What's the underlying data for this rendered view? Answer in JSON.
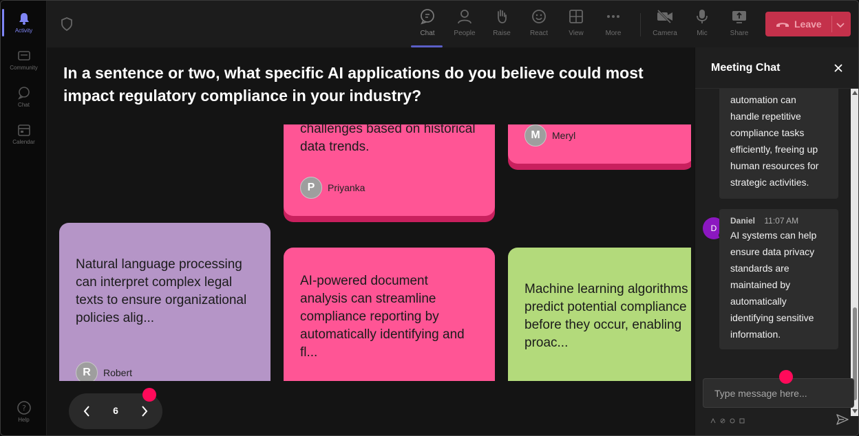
{
  "rail": {
    "items": [
      {
        "label": "Activity",
        "active": true
      },
      {
        "label": "Community",
        "active": false
      },
      {
        "label": "Chat",
        "active": false
      },
      {
        "label": "Calendar",
        "active": false
      }
    ],
    "help_label": "Help"
  },
  "toolbar": {
    "chat": "Chat",
    "people": "People",
    "raise": "Raise",
    "react": "React",
    "view": "View",
    "more": "More",
    "camera": "Camera",
    "mic": "Mic",
    "share": "Share",
    "leave": "Leave"
  },
  "question": "In a sentence or two, what specific AI applications do you believe could most impact regulatory compliance in your industry?",
  "cards": [
    {
      "text": "challenges based on historical data trends.",
      "initial": "P",
      "author": "Priyanka",
      "color": "#ff5595"
    },
    {
      "text": "",
      "initial": "M",
      "author": "Meryl",
      "color": "#ff5595"
    },
    {
      "text": "Natural language processing can interpret complex legal texts to ensure organizational policies alig...",
      "initial": "R",
      "author": "Robert",
      "color": "#b595c7"
    },
    {
      "text": "AI-powered document analysis can streamline compliance reporting by automatically identifying and fl...",
      "initial": "",
      "author": "",
      "color": "#ff5595"
    },
    {
      "text": "Machine learning algorithms can predict potential compliance risks before they occur, enabling proac...",
      "initial": "",
      "author": "",
      "color": "#b3da7b"
    }
  ],
  "pager": {
    "page": "6"
  },
  "chat": {
    "title": "Meeting Chat",
    "messages": [
      {
        "text_lines": [
          "automation can",
          "handle repetitive",
          "compliance tasks",
          "efficiently, freeing up",
          "human resources for",
          "strategic activities."
        ]
      },
      {
        "initial": "D",
        "name": "Daniel",
        "time": "11:07 AM",
        "text_lines": [
          "AI systems can help",
          "ensure data privacy",
          "standards are",
          "maintained by",
          "automatically",
          "identifying sensitive",
          "information."
        ]
      }
    ],
    "input_placeholder": "Type message here..."
  },
  "colors": {
    "accent": "#5b5fc7",
    "leave": "#c4314b",
    "dot": "#ff0a5a",
    "pink": "#ff5595",
    "purple": "#b595c7",
    "green": "#b3da7b"
  }
}
